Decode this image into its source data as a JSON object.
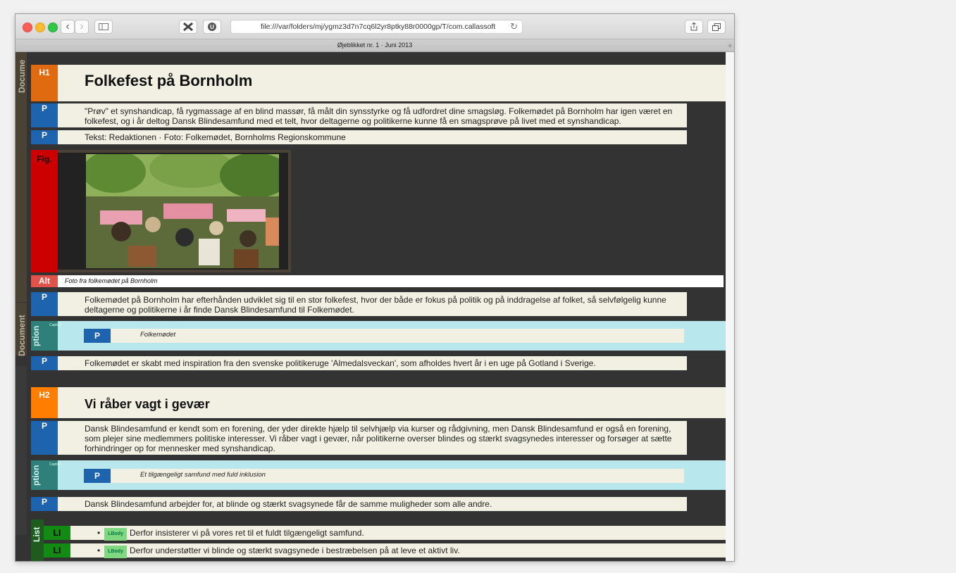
{
  "browser": {
    "url": "file:///var/folders/mj/ygmz3d7n7cq6l2yr8ptky88r0000gp/T/com.callassoft",
    "tab_title": "Øjeblikket nr. 1 · Juni 2013",
    "back_glyph": "‹",
    "forward_glyph": "›",
    "new_tab_glyph": "+"
  },
  "tags": {
    "document": "Document",
    "document_top": "Docume",
    "h1": "H1",
    "h2": "H2",
    "p": "P",
    "fig": "Fig.",
    "alt": "Alt",
    "caption": "Caption",
    "caption_side": "ption",
    "list": "List",
    "li": "LI",
    "lbody": "LBody"
  },
  "content": {
    "h1": "Folkefest på Bornholm",
    "p1": "\"Prøv\" et synshandicap, få rygmassage af en blind massør, få målt din synsstyrke og få udfordret dine smagsløg. Folkemødet på Bornholm har igen været en folkefest, og i år deltog Dansk Blindesamfund med et telt, hvor deltagerne og politikerne kunne få en smagsprøve på livet med et synshandicap.",
    "p2": "Tekst: Redaktionen · Foto: Folkemødet, Bornholms Regionskommune",
    "alt": "Foto fra folkemødet på Bornholm",
    "p3": "Folkemødet på Bornholm har efterhånden udviklet sig til en stor folkefest, hvor der både er fokus på politik og på inddragelse af folket, så selvfølgelig kunne deltagerne og politikerne i år finde Dansk Blindesamfund til Folkemødet.",
    "caption1": "Folkemødet",
    "p4": "Folkemødet er skabt med inspiration fra den svenske politikeruge 'Almedalsveckan', som afholdes hvert år i en uge på Gotland i Sverige.",
    "h2": "Vi råber vagt i gevær",
    "p5": "Dansk Blindesamfund er kendt som en forening, der yder direkte hjælp til selvhjælp via kurser og rådgivning, men Dansk Blindesamfund er også en forening, som plejer sine medlemmers politiske interesser. Vi råber vagt i gevær, når politikerne overser blindes og stærkt svagsynedes interesser og forsøger at sætte forhindringer op for mennesker med synshandicap.",
    "caption2": "Et tilgængeligt samfund med fuld inklusion",
    "p6": "Dansk Blindesamfund arbejder for, at blinde og stærkt svagsynede får de samme muligheder som alle andre.",
    "li1": "Derfor insisterer vi på vores ret til et fuldt tilgængeligt samfund.",
    "li2": "Derfor understøtter vi blinde og stærkt svagsynede i bestræbelsen på at leve et aktivt liv."
  },
  "colors": {
    "h1_tag": "#e06a10",
    "h2_tag": "#ff7d00",
    "p_tag": "#1d63ae",
    "fig_tag": "#cc0000",
    "alt_tag": "#e0524a",
    "caption_bg": "#b8e8ee",
    "list_bg": "#1f5a1f",
    "li_tag": "#138a13"
  }
}
